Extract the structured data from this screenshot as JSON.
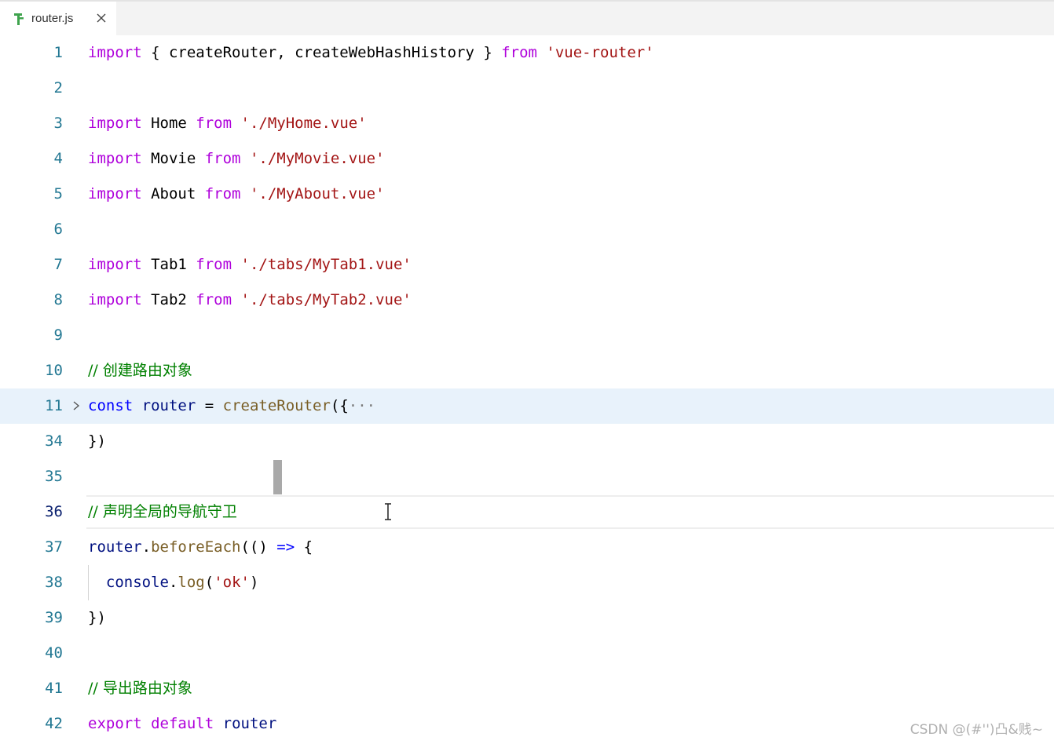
{
  "tab": {
    "filename": "router.js",
    "icon": "router-file-icon",
    "close_icon": "close-icon"
  },
  "colors": {
    "keyword": "#af00db",
    "string": "#a31515",
    "variable": "#001080",
    "function": "#795e26",
    "declaration": "#0000ff",
    "comment": "#008000",
    "line_number": "#237893",
    "highlight": "#e8f2fb"
  },
  "editor": {
    "lines": [
      {
        "n": "1",
        "tokens": [
          [
            "kw",
            "import"
          ],
          [
            "",
            " { createRouter, createWebHashHistory } "
          ],
          [
            "kw",
            "from"
          ],
          [
            "",
            " "
          ],
          [
            "str",
            "'vue-router'"
          ]
        ]
      },
      {
        "n": "2",
        "tokens": []
      },
      {
        "n": "3",
        "tokens": [
          [
            "kw",
            "import"
          ],
          [
            "",
            " Home "
          ],
          [
            "kw",
            "from"
          ],
          [
            "",
            " "
          ],
          [
            "str",
            "'./MyHome.vue'"
          ]
        ]
      },
      {
        "n": "4",
        "tokens": [
          [
            "kw",
            "import"
          ],
          [
            "",
            " Movie "
          ],
          [
            "kw",
            "from"
          ],
          [
            "",
            " "
          ],
          [
            "str",
            "'./MyMovie.vue'"
          ]
        ]
      },
      {
        "n": "5",
        "tokens": [
          [
            "kw",
            "import"
          ],
          [
            "",
            " About "
          ],
          [
            "kw",
            "from"
          ],
          [
            "",
            " "
          ],
          [
            "str",
            "'./MyAbout.vue'"
          ]
        ]
      },
      {
        "n": "6",
        "tokens": []
      },
      {
        "n": "7",
        "tokens": [
          [
            "kw",
            "import"
          ],
          [
            "",
            " Tab1 "
          ],
          [
            "kw",
            "from"
          ],
          [
            "",
            " "
          ],
          [
            "str",
            "'./tabs/MyTab1.vue'"
          ]
        ]
      },
      {
        "n": "8",
        "tokens": [
          [
            "kw",
            "import"
          ],
          [
            "",
            " Tab2 "
          ],
          [
            "kw",
            "from"
          ],
          [
            "",
            " "
          ],
          [
            "str",
            "'./tabs/MyTab2.vue'"
          ]
        ]
      },
      {
        "n": "9",
        "tokens": []
      },
      {
        "n": "10",
        "tokens": [
          [
            "cmt",
            "// 创建路由对象"
          ]
        ]
      },
      {
        "n": "11",
        "fold": true,
        "highlight": true,
        "tokens": [
          [
            "decl",
            "const"
          ],
          [
            "",
            " "
          ],
          [
            "var",
            "router"
          ],
          [
            "",
            " = "
          ],
          [
            "fn",
            "createRouter"
          ],
          [
            "",
            "({"
          ],
          [
            "ell",
            "···"
          ]
        ]
      },
      {
        "n": "34",
        "tokens": [
          [
            "",
            "})"
          ]
        ]
      },
      {
        "n": "35",
        "tokens": []
      },
      {
        "n": "36",
        "current": true,
        "tokens": [
          [
            "cmt",
            "// 声明全局的导航守卫"
          ]
        ]
      },
      {
        "n": "37",
        "tokens": [
          [
            "var",
            "router"
          ],
          [
            "",
            "."
          ],
          [
            "fn",
            "beforeEach"
          ],
          [
            "",
            "(() "
          ],
          [
            "decl",
            "=>"
          ],
          [
            "",
            " {"
          ]
        ]
      },
      {
        "n": "38",
        "guide": true,
        "tokens": [
          [
            "",
            "  "
          ],
          [
            "var",
            "console"
          ],
          [
            "",
            "."
          ],
          [
            "fn",
            "log"
          ],
          [
            "",
            "("
          ],
          [
            "str",
            "'ok'"
          ],
          [
            "",
            ")"
          ]
        ]
      },
      {
        "n": "39",
        "tokens": [
          [
            "",
            "})"
          ]
        ]
      },
      {
        "n": "40",
        "tokens": []
      },
      {
        "n": "41",
        "tokens": [
          [
            "cmt",
            "// 导出路由对象"
          ]
        ]
      },
      {
        "n": "42",
        "tokens": [
          [
            "kw",
            "export"
          ],
          [
            "",
            " "
          ],
          [
            "kw",
            "default"
          ],
          [
            "",
            " "
          ],
          [
            "var",
            "router"
          ]
        ]
      }
    ]
  },
  "watermark": "CSDN @(#'')凸&贱~"
}
